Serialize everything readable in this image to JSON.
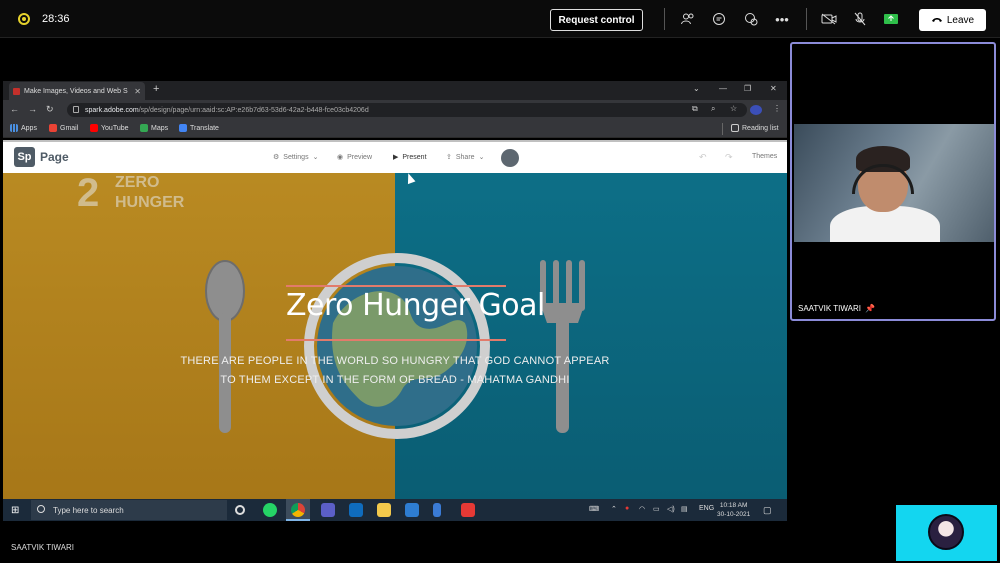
{
  "meeting": {
    "timer": "28:36",
    "request_control_label": "Request control",
    "leave_label": "Leave",
    "presenter_name": "SAATVIK TIWARI"
  },
  "browser": {
    "tab_title": "Make Images, Videos and Web S",
    "url_host": "spark.adobe.com",
    "url_path": "/sp/design/page/urn:aaid:sc:AP:e26b7d63-53d6-42a2-b448-fce03cb4206d",
    "bookmarks": [
      "Apps",
      "Gmail",
      "YouTube",
      "Maps",
      "Translate"
    ],
    "reading_list_label": "Reading list"
  },
  "spark": {
    "logo_text": "Sp",
    "app_name": "Page",
    "settings_label": "Settings",
    "preview_label": "Preview",
    "present_label": "Present",
    "share_label": "Share",
    "themes_label": "Themes"
  },
  "slide": {
    "sdg_number": "2",
    "sdg_line1": "ZERO",
    "sdg_line2": "HUNGER",
    "title": "Zero Hunger Goal",
    "quote_line1": "THERE ARE PEOPLE IN THE WORLD SO HUNGRY THAT GOD CANNOT APPEAR",
    "quote_line2": "TO THEM EXCEPT IN THE FORM OF BREAD - MAHATMA GANDHI"
  },
  "taskbar": {
    "search_placeholder": "Type here to search",
    "lang": "ENG",
    "time": "10:18 AM",
    "date": "30-10-2021"
  },
  "participant": {
    "name": "SAATVIK TIWARI"
  }
}
